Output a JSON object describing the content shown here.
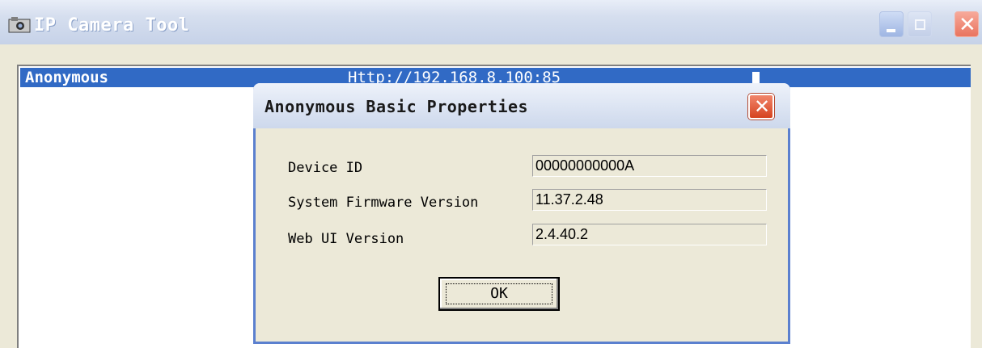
{
  "window": {
    "title": "IP Camera Tool",
    "icon": "camera-app-icon",
    "controls": [
      "minimize-icon",
      "maximize-icon",
      "close-icon"
    ]
  },
  "camera_list": {
    "rows": [
      {
        "name": "Anonymous",
        "url": "Http://192.168.8.100:85",
        "selected": true
      }
    ]
  },
  "dialog": {
    "title": "Anonymous Basic Properties",
    "properties": [
      {
        "label": "Device ID",
        "value": "00000000000A"
      },
      {
        "label": "System Firmware Version",
        "value": "11.37.2.48"
      },
      {
        "label": "Web UI Version",
        "value": "2.4.40.2"
      }
    ],
    "ok_label": "OK"
  },
  "colors": {
    "selection": "#316ac5",
    "window_bg": "#ece9d8",
    "dialog_border": "#5b80cf",
    "close_red": "#d6431f"
  }
}
